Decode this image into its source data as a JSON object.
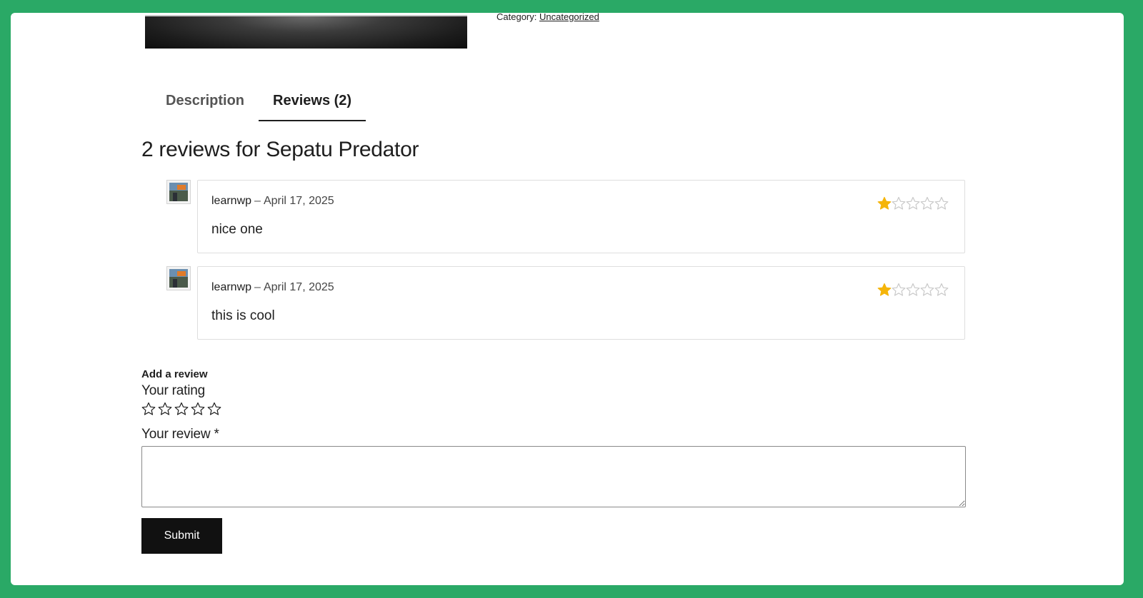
{
  "product": {
    "category_label": "Category:",
    "category_link": "Uncategorized"
  },
  "tabs": [
    {
      "label": "Description",
      "active": false
    },
    {
      "label": "Reviews (2)",
      "active": true
    }
  ],
  "reviews_heading": "2 reviews for Sepatu Predator",
  "reviews": [
    {
      "author": "learnwp",
      "separator": "–",
      "date": "April 17, 2025",
      "text": "nice one",
      "rating": 1,
      "max_rating": 5
    },
    {
      "author": "learnwp",
      "separator": "–",
      "date": "April 17, 2025",
      "text": "this is cool",
      "rating": 1,
      "max_rating": 5
    }
  ],
  "form": {
    "title": "Add a review",
    "rating_label": "Your rating",
    "rating_options": 5,
    "review_label": "Your review *",
    "review_value": "",
    "submit_label": "Submit"
  },
  "colors": {
    "page_background": "#2aa966",
    "star_filled": "#f5b50a",
    "star_empty": "#c9c9c9",
    "submit_background": "#111111"
  }
}
